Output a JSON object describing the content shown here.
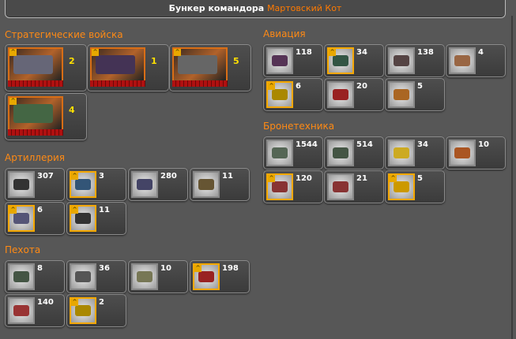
{
  "header": {
    "title": "Бункер командора",
    "commander": "Мартовский Кот"
  },
  "colors": {
    "accent": "#ff8a14",
    "elite_border": "#f5a800",
    "count": "#ffffff",
    "strategic_count": "#ffe000"
  },
  "sections": {
    "strategic": {
      "title": "Стратегические войска",
      "units": [
        {
          "count": "2",
          "elite": true,
          "color": "#667"
        },
        {
          "count": "1",
          "elite": true,
          "color": "#435"
        },
        {
          "count": "5",
          "elite": true,
          "color": "#666"
        },
        {
          "count": "4",
          "elite": true,
          "color": "#464"
        }
      ]
    },
    "artillery": {
      "title": "Артиллерия",
      "units": [
        {
          "count": "307",
          "elite": false,
          "color": "#333"
        },
        {
          "count": "3",
          "elite": true,
          "color": "#357"
        },
        {
          "count": "280",
          "elite": false,
          "color": "#446"
        },
        {
          "count": "11",
          "elite": false,
          "color": "#653"
        },
        {
          "count": "6",
          "elite": true,
          "color": "#557"
        },
        {
          "count": "11",
          "elite": true,
          "color": "#333"
        }
      ]
    },
    "infantry": {
      "title": "Пехота",
      "units": [
        {
          "count": "8",
          "elite": false,
          "color": "#454"
        },
        {
          "count": "36",
          "elite": false,
          "color": "#555"
        },
        {
          "count": "10",
          "elite": false,
          "color": "#775"
        },
        {
          "count": "198",
          "elite": true,
          "color": "#922"
        },
        {
          "count": "140",
          "elite": false,
          "color": "#933"
        },
        {
          "count": "2",
          "elite": true,
          "color": "#a80"
        }
      ]
    },
    "aviation": {
      "title": "Авиация",
      "units": [
        {
          "count": "118",
          "elite": false,
          "color": "#535"
        },
        {
          "count": "34",
          "elite": true,
          "color": "#354"
        },
        {
          "count": "138",
          "elite": false,
          "color": "#544"
        },
        {
          "count": "4",
          "elite": false,
          "color": "#964"
        },
        {
          "count": "6",
          "elite": true,
          "color": "#a80"
        },
        {
          "count": "20",
          "elite": false,
          "color": "#922"
        },
        {
          "count": "5",
          "elite": false,
          "color": "#a62"
        }
      ]
    },
    "armor": {
      "title": "Бронетехника",
      "units": [
        {
          "count": "1544",
          "elite": false,
          "color": "#565"
        },
        {
          "count": "514",
          "elite": false,
          "color": "#454"
        },
        {
          "count": "34",
          "elite": false,
          "color": "#ca2"
        },
        {
          "count": "10",
          "elite": false,
          "color": "#a52"
        },
        {
          "count": "120",
          "elite": true,
          "color": "#833"
        },
        {
          "count": "21",
          "elite": false,
          "color": "#833"
        },
        {
          "count": "5",
          "elite": true,
          "color": "#c90"
        }
      ]
    }
  }
}
